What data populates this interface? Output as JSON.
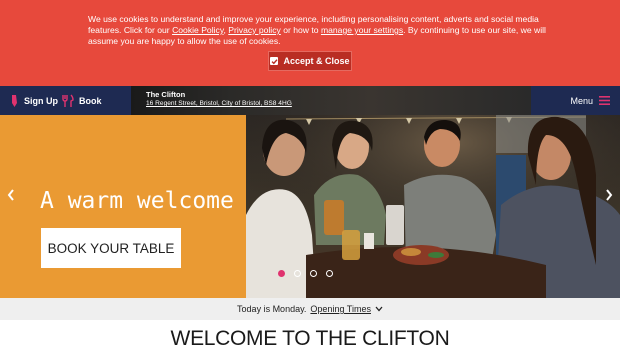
{
  "cookie_banner": {
    "text_1": "We use cookies to understand and improve your experience, including personalising content, adverts and social media features. Click for our ",
    "cookie_policy_link": "Cookie Policy",
    "sep": ", ",
    "privacy_policy_link": "Privacy policy",
    "text_2": " or how to ",
    "manage_settings_link": "manage your settings",
    "text_3": ". By continuing to use our site, we will assume you are happy to allow the use of cookies.",
    "accept_label": "Accept & Close"
  },
  "nav": {
    "signup_label": "Sign Up",
    "book_label": "Book",
    "venue_name": "The Clifton",
    "venue_address": "16 Regent Street, Bristol, City of Bristol, BS8 4HG",
    "menu_label": "Menu"
  },
  "hero": {
    "headline": "A warm welcome",
    "cta_label": "BOOK YOUR TABLE",
    "slide_count": 4,
    "active_slide": 1
  },
  "hours": {
    "today_text": "Today is Monday.",
    "opening_link": "Opening Times"
  },
  "welcome_heading": "WELCOME TO THE CLIFTON",
  "colors": {
    "cookie_bg": "#e7493c",
    "nav_bg": "#1e2a52",
    "accent_pink": "#e0336f",
    "hero_orange": "#ea9a33"
  },
  "icons": {
    "signup": "pen-icon",
    "book": "cutlery-icon",
    "menu": "hamburger-icon"
  }
}
